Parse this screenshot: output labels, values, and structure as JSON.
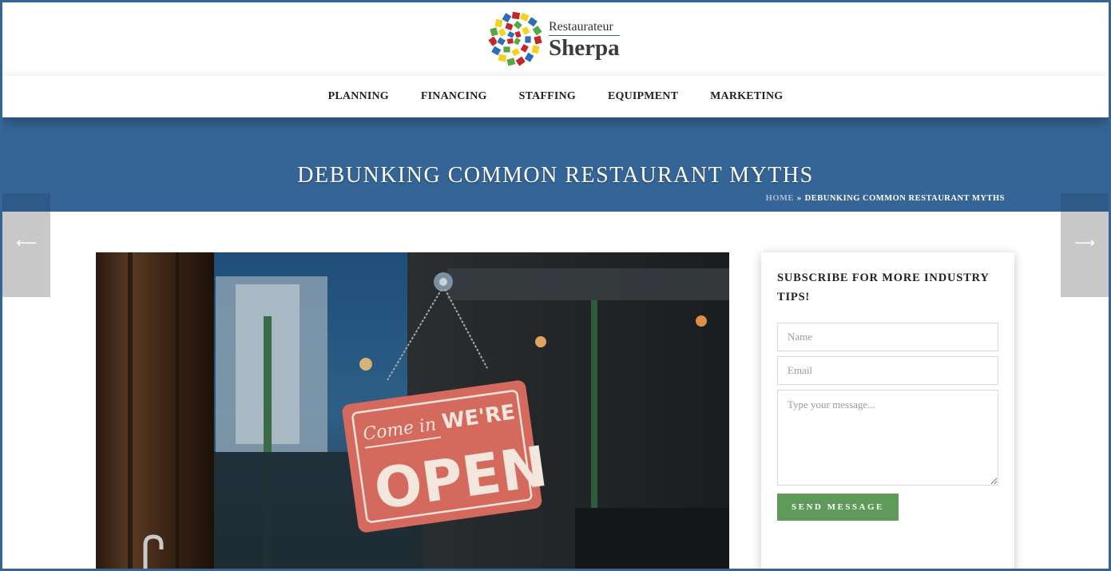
{
  "brand": {
    "line1": "Restaurateur",
    "line2": "Sherpa",
    "logo_icon": "mosaic-spiral-logo-icon"
  },
  "nav": {
    "items": [
      {
        "label": "PLANNING"
      },
      {
        "label": "FINANCING"
      },
      {
        "label": "STAFFING"
      },
      {
        "label": "EQUIPMENT"
      },
      {
        "label": "MARKETING"
      }
    ]
  },
  "page": {
    "title": "DEBUNKING COMMON RESTAURANT MYTHS"
  },
  "breadcrumb": {
    "home": "HOME",
    "separator": "»",
    "current": "DEBUNKING COMMON RESTAURANT MYTHS"
  },
  "navigation_arrows": {
    "prev_icon": "arrow-left-icon",
    "next_icon": "arrow-right-icon",
    "prev_glyph": "⟵",
    "next_glyph": "⟶"
  },
  "hero": {
    "sign_script": "Come in",
    "sign_top": "WE'RE",
    "sign_main": "OPEN"
  },
  "subscribe": {
    "title": "SUBSCRIBE FOR MORE INDUSTRY TIPS!",
    "name_placeholder": "Name",
    "email_placeholder": "Email",
    "message_placeholder": "Type your message...",
    "button_label": "SEND MESSAGE"
  },
  "colors": {
    "brand_blue": "#356596",
    "button_green": "#5f9a5a",
    "arrow_gray": "#c8c8c8"
  }
}
